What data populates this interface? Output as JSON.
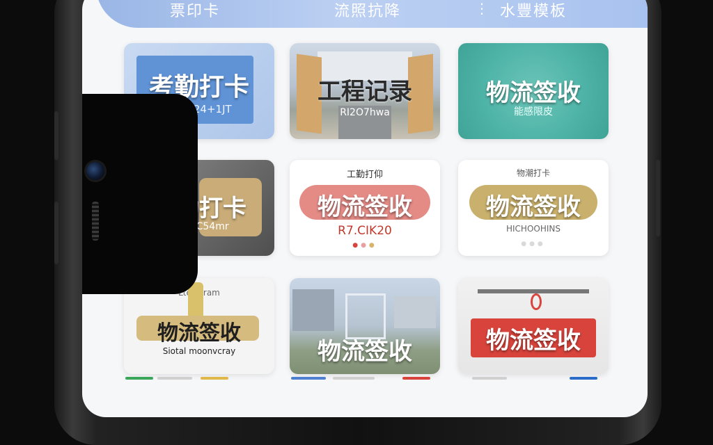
{
  "tabs": [
    {
      "label": "票印卡"
    },
    {
      "label": "流照抗降"
    },
    {
      "label": "水豐模板",
      "icon": "⋮"
    }
  ],
  "cards": [
    {
      "title": "考勤打卡",
      "subtitle": "BT4324+1JT",
      "style": "blue-stamp"
    },
    {
      "title": "工程记录",
      "subtitle": "RI2O7hwa",
      "style": "construction-site"
    },
    {
      "title": "物流签收",
      "subtitle": "能感限皮",
      "style": "teal-burst"
    },
    {
      "title": "考勤打卡",
      "subtitle": "PRORC54mr",
      "style": "dark-spool"
    },
    {
      "title": "物流签收",
      "overline": "工勤打仰",
      "subtitle": "R7.CIK20",
      "style": "red-brush"
    },
    {
      "title": "物流签收",
      "overline": "物潮打卡",
      "subtitle": "HICHOOHINS",
      "style": "gold-brush"
    },
    {
      "title": "物流签收",
      "overline": "Lteratram",
      "subtitle": "Siotal moonvcray",
      "style": "wood-beam"
    },
    {
      "title": "物流签收",
      "subtitle": "",
      "style": "building"
    },
    {
      "title": "物流签收",
      "subtitle": "",
      "style": "red-banner"
    }
  ],
  "colors": {
    "banner": "#a9c2ef",
    "teal": "#4fb4a8",
    "blue_stamp": "#5f93d6",
    "red_accent": "#d8443c",
    "gold": "#c9b06c"
  }
}
